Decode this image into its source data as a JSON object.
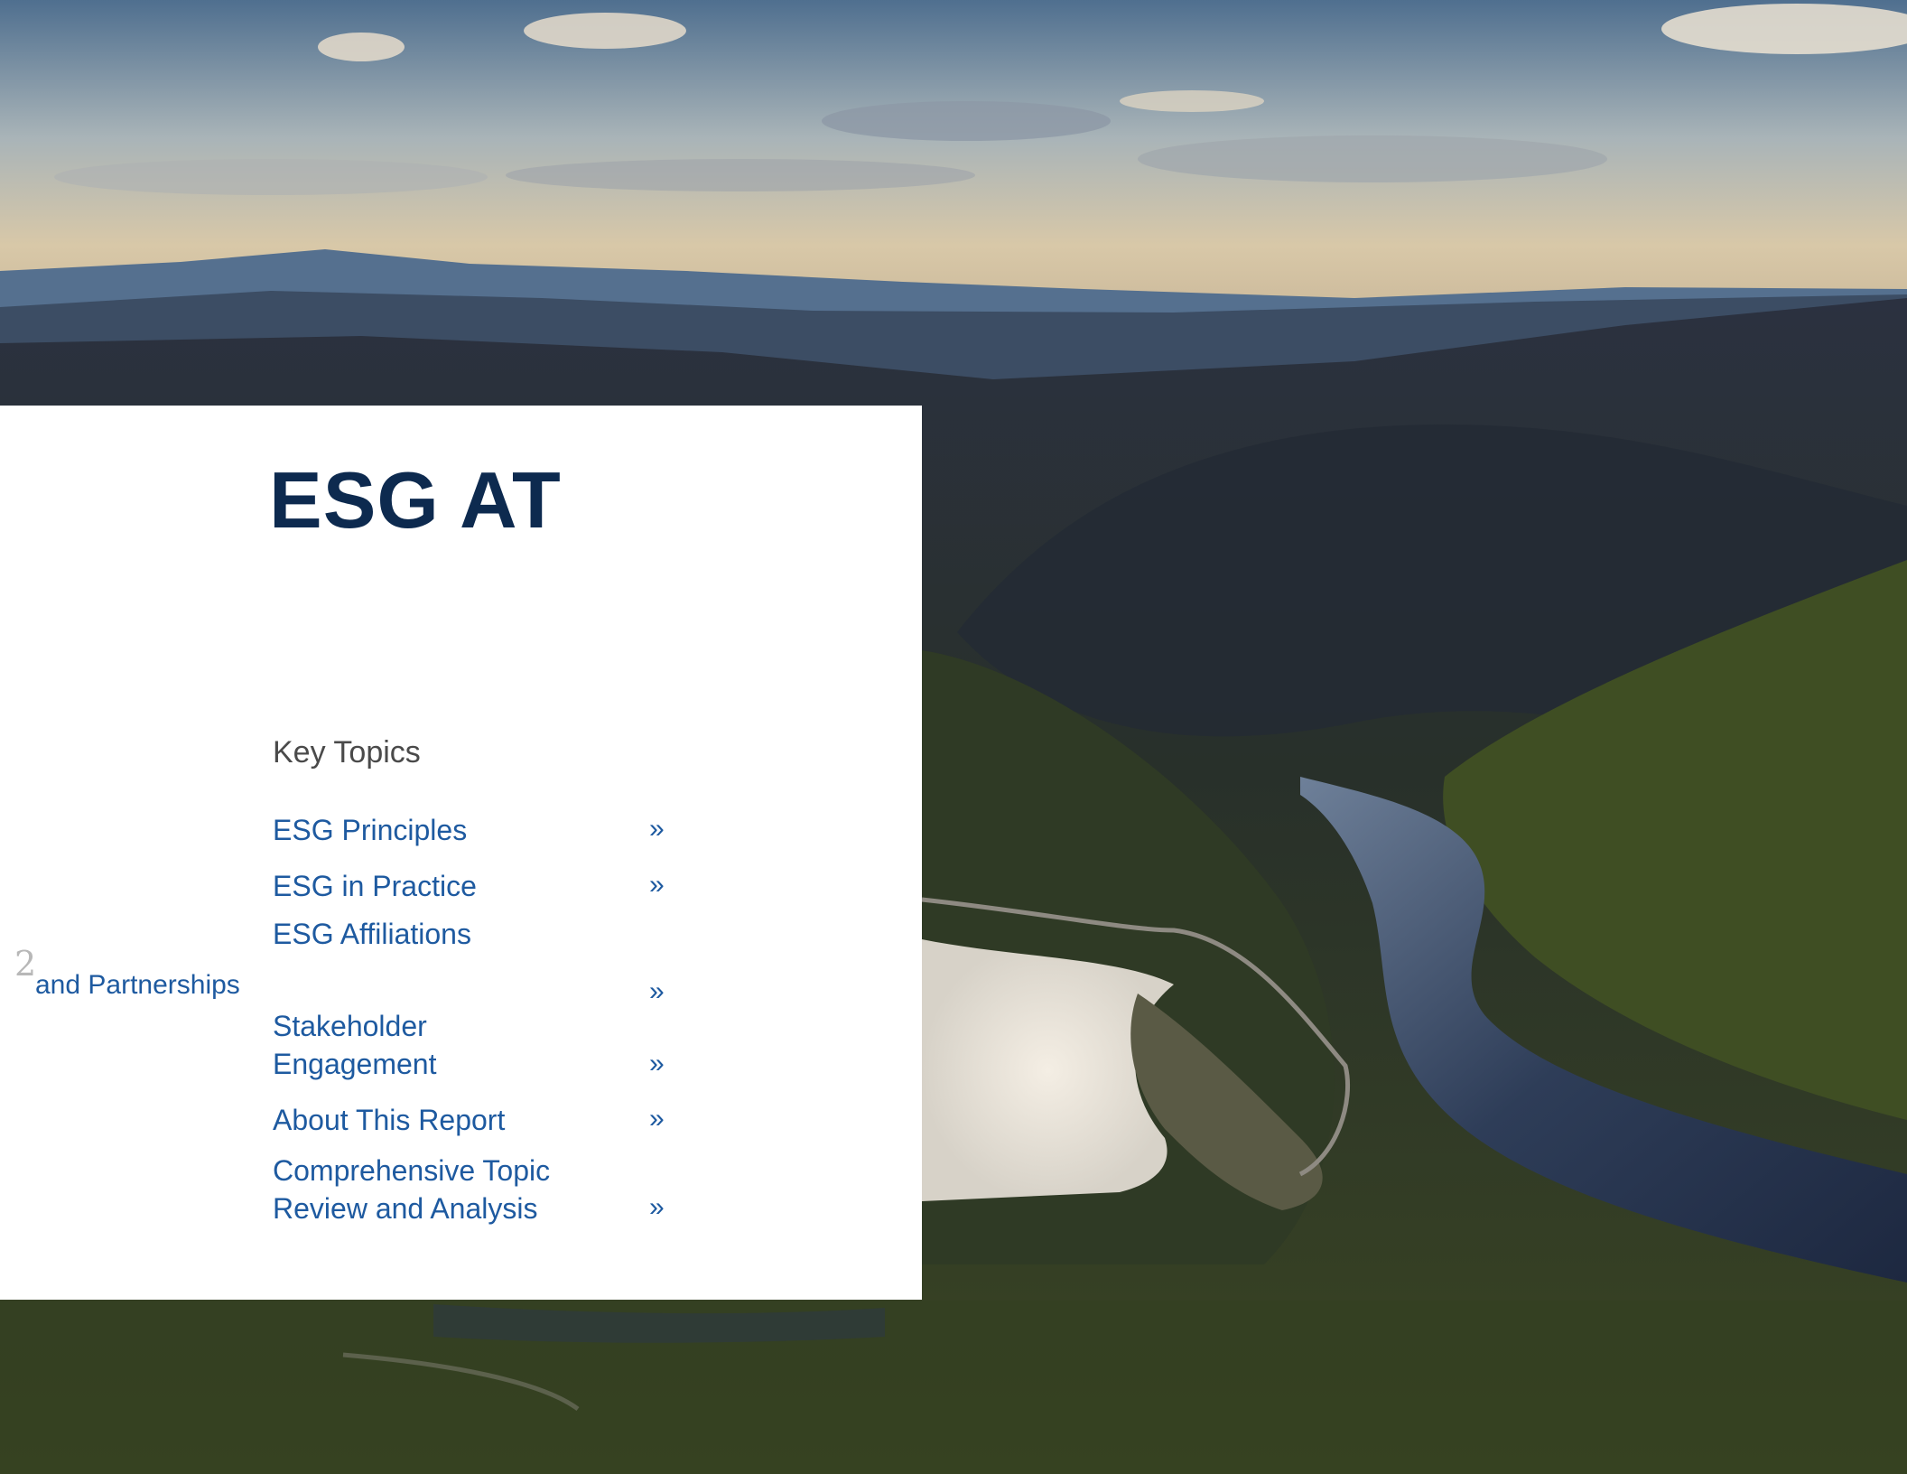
{
  "title": "ESG AT",
  "key_topics_heading": "Key Topics",
  "topics": [
    {
      "label": "ESG Principles",
      "arrow": "»"
    },
    {
      "label": "ESG in Practice",
      "arrow": "»"
    },
    {
      "label": "ESG Affiliations",
      "arrow": "»"
    },
    {
      "label": "Stakeholder",
      "label2": "Engagement",
      "arrow": "»"
    },
    {
      "label": "About This Report",
      "arrow": "»"
    },
    {
      "label": "Comprehensive Topic",
      "label2": "Review and Analysis",
      "arrow": "»"
    }
  ],
  "stray_text": "and Partnerships",
  "page_number": "2",
  "colors": {
    "title": "#0d2a4f",
    "link": "#1e5aa0",
    "heading": "#4a4a4a"
  }
}
